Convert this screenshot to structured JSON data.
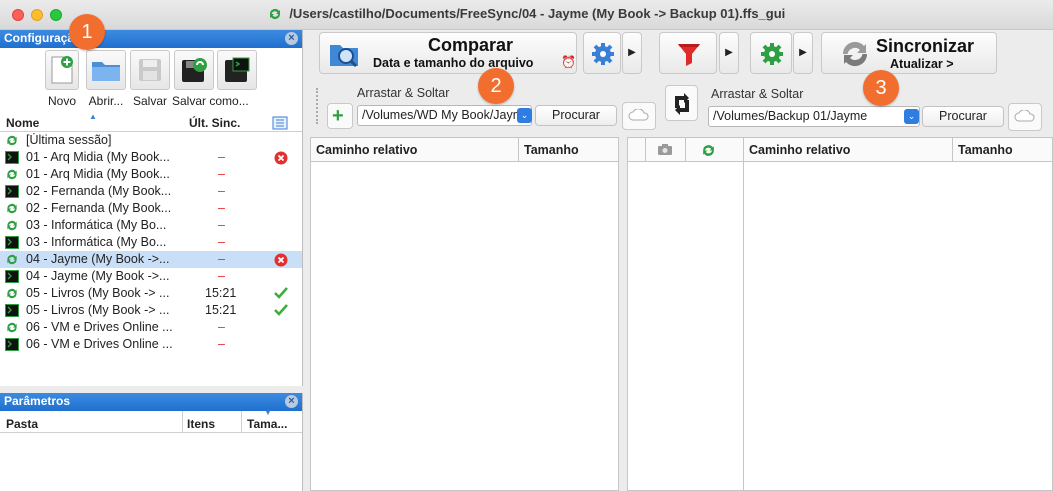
{
  "window": {
    "title": "/Users/castilho/Documents/FreeSync/04 - Jayme (My Book -> Backup 01).ffs_gui"
  },
  "config_panel": {
    "title": "Configuração",
    "toolbar": {
      "new_label": "Novo",
      "open_label": "Abrir...",
      "save_label": "Salvar",
      "save_as_label": "Salvar como..."
    },
    "columns": {
      "name": "Nome",
      "last_sync": "Últ. Sinc."
    },
    "rows": [
      {
        "name": "[Última sessão]",
        "type": "sync",
        "time": "",
        "status": ""
      },
      {
        "name": "01 - Arq Midia (My Book...",
        "type": "batch",
        "time": "–",
        "status": "error"
      },
      {
        "name": "01 - Arq Midia (My Book...",
        "type": "sync",
        "time": "–",
        "status": ""
      },
      {
        "name": "02 - Fernanda (My Book...",
        "type": "batch",
        "time": "–",
        "status": ""
      },
      {
        "name": "02 - Fernanda (My Book...",
        "type": "sync",
        "time": "–",
        "status": ""
      },
      {
        "name": "03 - Informática (My Bo...",
        "type": "sync",
        "time": "–",
        "status": ""
      },
      {
        "name": "03 - Informática (My Bo...",
        "type": "batch",
        "time": "–",
        "status": ""
      },
      {
        "name": "04 - Jayme (My Book ->...",
        "type": "sync",
        "time": "–",
        "status": "error",
        "selected": true
      },
      {
        "name": "04 - Jayme (My Book ->...",
        "type": "batch",
        "time": "–",
        "status": ""
      },
      {
        "name": "05 - Livros (My Book -> ...",
        "type": "sync",
        "time": "15:21",
        "status": "ok"
      },
      {
        "name": "05 - Livros (My Book -> ...",
        "type": "batch",
        "time": "15:21",
        "status": "ok"
      },
      {
        "name": "06 - VM e Drives Online ...",
        "type": "sync",
        "time": "–",
        "status": ""
      },
      {
        "name": "06 - VM e Drives Online ...",
        "type": "batch",
        "time": "–",
        "status": ""
      }
    ]
  },
  "params_panel": {
    "title": "Parâmetros",
    "columns": {
      "folder": "Pasta",
      "items": "Itens",
      "size": "Tama..."
    }
  },
  "toolbar": {
    "compare_title": "Comparar",
    "compare_subtitle": "Data e tamanho do arquivo",
    "sync_title": "Sincronizar",
    "sync_subtitle": "Atualizar >"
  },
  "left_folder": {
    "drag_label": "Arrastar & Soltar",
    "path": "/Volumes/WD My Book/Jayme",
    "browse_label": "Procurar"
  },
  "right_folder": {
    "drag_label": "Arrastar & Soltar",
    "path": "/Volumes/Backup 01/Jayme",
    "browse_label": "Procurar"
  },
  "left_grid": {
    "col_path": "Caminho relativo",
    "col_size": "Tamanho"
  },
  "right_grid": {
    "col_path": "Caminho relativo",
    "col_size": "Tamanho"
  },
  "badges": {
    "b1": "1",
    "b2": "2",
    "b3": "3"
  },
  "colors": {
    "accent": "#1f6fcf",
    "badge": "#f26e2e",
    "error": "#e23030",
    "ok": "#3cae3c"
  }
}
